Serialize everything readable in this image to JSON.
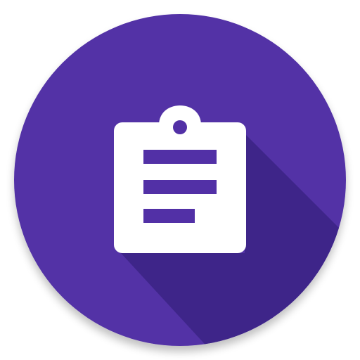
{
  "app_icon": {
    "icon_name": "clipboard-document-icon",
    "colors": {
      "background": "#ffffff",
      "circle": "#5230a6",
      "long_shadow": "#3e2589",
      "clipboard": "#ffffff",
      "text_lines": "#5230a6"
    }
  }
}
